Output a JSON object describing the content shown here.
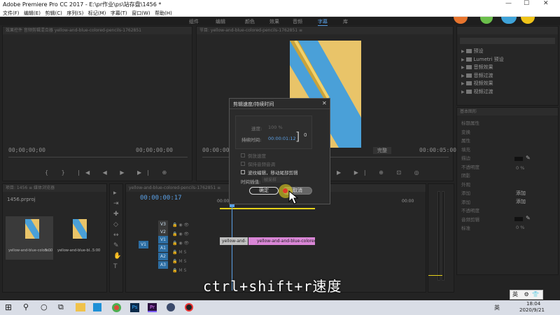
{
  "window": {
    "title": "Adobe Premiere Pro CC 2017 - E:\\pr作业\\ps\\站存盘\\1456 *"
  },
  "menu": [
    "文件(F)",
    "编辑(E)",
    "剪辑(C)",
    "序列(S)",
    "标记(M)",
    "字幕(T)",
    "窗口(W)",
    "帮助(H)"
  ],
  "workspaces": [
    "组件",
    "编辑",
    "颜色",
    "效果",
    "音频",
    "字幕",
    "库"
  ],
  "active_workspace": "字幕",
  "source_monitor": {
    "header": "效果控件  音频剪辑混合器  yellow-and-blue-colored-pencils-1762851",
    "timecode_left": "00;00;00;00",
    "timecode_right": "00;00;00;00"
  },
  "program_monitor": {
    "header": "节目: yellow-and-blue-colored-pencils-1762851  ≡",
    "timecode_left": "00:00:00:00",
    "timecode_right": "00:00:05:00",
    "fit": "完整"
  },
  "effects_panel": {
    "items": [
      "预设",
      "Lumetri 预设",
      "音频效果",
      "音频过渡",
      "视频效果",
      "视频过渡"
    ]
  },
  "essential_graphics": {
    "header": "基本图形",
    "rows": [
      "标题属性",
      "变换",
      "属性",
      "填充",
      "描边",
      "不透明度",
      "阴影",
      "外观",
      "添加",
      "添加",
      "不透明度"
    ],
    "add1": "添加",
    "add2": "添加",
    "opacity1": "0 %",
    "opacity2": "0 %",
    "section2": "音频剪辑",
    "section3": "标准"
  },
  "project_panel": {
    "header": "项目: 1456  ≡  媒体浏览器",
    "file": "1456.prproj",
    "items": [
      {
        "name": "yellow-and-blue-colore...",
        "dur": "5:00"
      },
      {
        "name": "yellow-and-blue-bl...",
        "dur": "5:00"
      }
    ]
  },
  "timeline": {
    "header": "yellow-and-blue-colored-pencils-1762851  ≡",
    "timecode": "00:00:00:17",
    "ruler_left": "00:00",
    "ruler_right": "00:00",
    "tracks": [
      "V3",
      "V2",
      "V1",
      "A1",
      "A2",
      "A3"
    ],
    "source_v": "V1",
    "clip1": "yellow-and-",
    "clip2": "yellow-and-and-blue-colored-pe"
  },
  "dialog": {
    "title": "剪辑速度/持续时间",
    "speed_label": "速度:",
    "speed_value": "100 %",
    "duration_label": "持续时间:",
    "duration_value": "00:00:01:12",
    "link_count": "0",
    "reverse": "倒放速度",
    "keep_pitch": "保持音频音调",
    "ripple": "波纹编辑，移动尾部剪辑",
    "interp_label": "时间插值:",
    "interp_value": "帧采样",
    "ok": "确定",
    "cancel": "取消"
  },
  "subtitle": "ctrl+shift+r速度",
  "taskbar": {
    "ime": "英",
    "time": "18:04",
    "date": "2020/9/21",
    "tray_lang": "英"
  },
  "colors": {
    "accent": "#5aa0e6",
    "clip_pink": "#d986d6",
    "track_blue": "#2d6ea3",
    "yellow_bar": "#e6d21a"
  }
}
